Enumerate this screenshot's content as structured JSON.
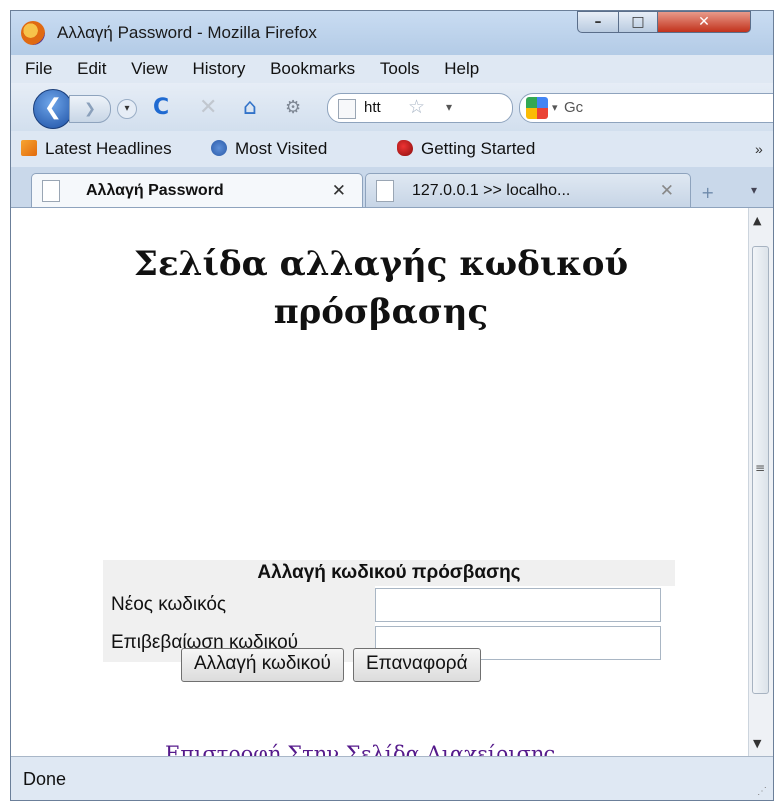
{
  "window": {
    "title": "Αλλαγή Password - Mozilla Firefox",
    "buttons": {
      "minimize": "–",
      "maximize": "□",
      "close": "✕"
    }
  },
  "menubar": {
    "items": [
      "File",
      "Edit",
      "View",
      "History",
      "Bookmarks",
      "Tools",
      "Help"
    ]
  },
  "navbar": {
    "back": "❮",
    "forward": "❯",
    "dropdown": "▾",
    "reload": "C",
    "stop": "✕",
    "home": "⌂",
    "addon": "⚙",
    "url_value": "htt",
    "star": "☆",
    "url_dropdown": "▾",
    "search_dropdown": "▾",
    "search_text": "Gc"
  },
  "bookmarks": {
    "items": [
      "Latest Headlines",
      "Most Visited",
      "Getting Started"
    ],
    "more": "»"
  },
  "tabs": [
    {
      "label": "Αλλαγή Password",
      "close": "✕"
    },
    {
      "label": "127.0.0.1 >> localho...",
      "close": "✕"
    }
  ],
  "tabstrip": {
    "new_tab": "+",
    "list": "▾"
  },
  "page": {
    "heading": "Σελίδα αλλαγής κωδικού πρόσβασης",
    "form": {
      "title": "Αλλαγή κωδικού πρόσβασης",
      "new_password_label": "Νέος κωδικός",
      "confirm_password_label": "Επιβεβαίωση κωδικού",
      "new_password_value": "",
      "confirm_password_value": "",
      "submit_label": "Αλλαγή κωδικού",
      "reset_label": "Επαναφορά"
    },
    "back_link": "Επιστροφή Στην Σελίδα Διαχείρισης"
  },
  "scrollbar": {
    "up": "▲",
    "down": "▼",
    "grip": "≡"
  },
  "status": {
    "text": "Done",
    "grip": "⋰"
  }
}
